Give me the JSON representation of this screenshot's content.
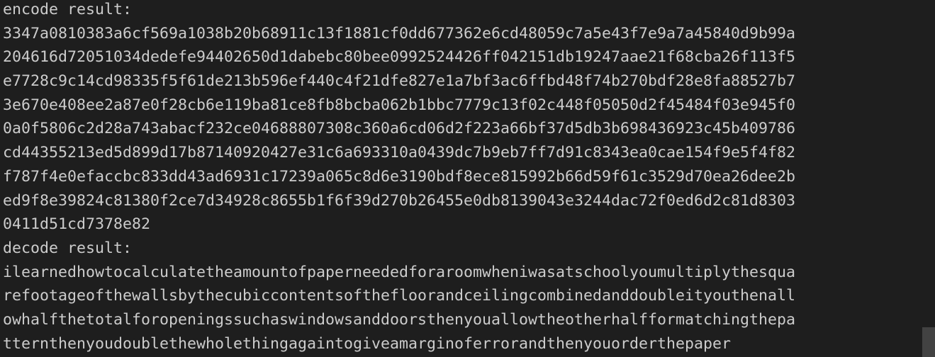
{
  "terminal": {
    "encode_label": "encode result:",
    "encode_lines": [
      "3347a0810383a6cf569a1038b20b68911c13f1881cf0dd677362e6cd48059c7a5e43f7e9a7a45840d9b99a",
      "204616d72051034dedefe94402650d1dabebc80bee0992524426ff042151db19247aae21f68cba26f113f5",
      "e7728c9c14cd98335f5f61de213b596ef440c4f21dfe827e1a7bf3ac6ffbd48f74b270bdf28e8fa88527b7",
      "3e670e408ee2a87e0f28cb6e119ba81ce8fb8bcba062b1bbc7779c13f02c448f05050d2f45484f03e945f0",
      "0a0f5806c2d28a743abacf232ce04688807308c360a6cd06d2f223a66bf37d5db3b698436923c45b409786",
      "cd44355213ed5d899d17b87140920427e31c6a693310a0439dc7b9eb7ff7d91c8343ea0cae154f9e5f4f82",
      "f787f4e0efaccbc833dd43ad6931c17239a065c8d6e3190bdf8ece815992b66d59f61c3529d70ea26dee2b",
      "ed9f8e39824c81380f2ce7d34928c8655b1f6f39d270b26455e0db8139043e3244dac72f0ed6d2c81d8303",
      "0411d51cd7378e82"
    ],
    "decode_label": "decode result:",
    "decode_lines": [
      "ilearnedhowtocalculatetheamountofpaperneededforaroomwheniwasatschoolyoumultiplythesqua",
      "refootageofthewallsbythecubiccontentsofthefloorandceilingcombinedanddoubleityouthenall",
      "owhalfthetotalforopeningssuchaswindowsanddoorsthenyouallowtheotherhalfformatchingthepa",
      "tternthenyoudoublethewholethingagaintogiveamarginoferrorandthenyouorderthepaper"
    ]
  }
}
